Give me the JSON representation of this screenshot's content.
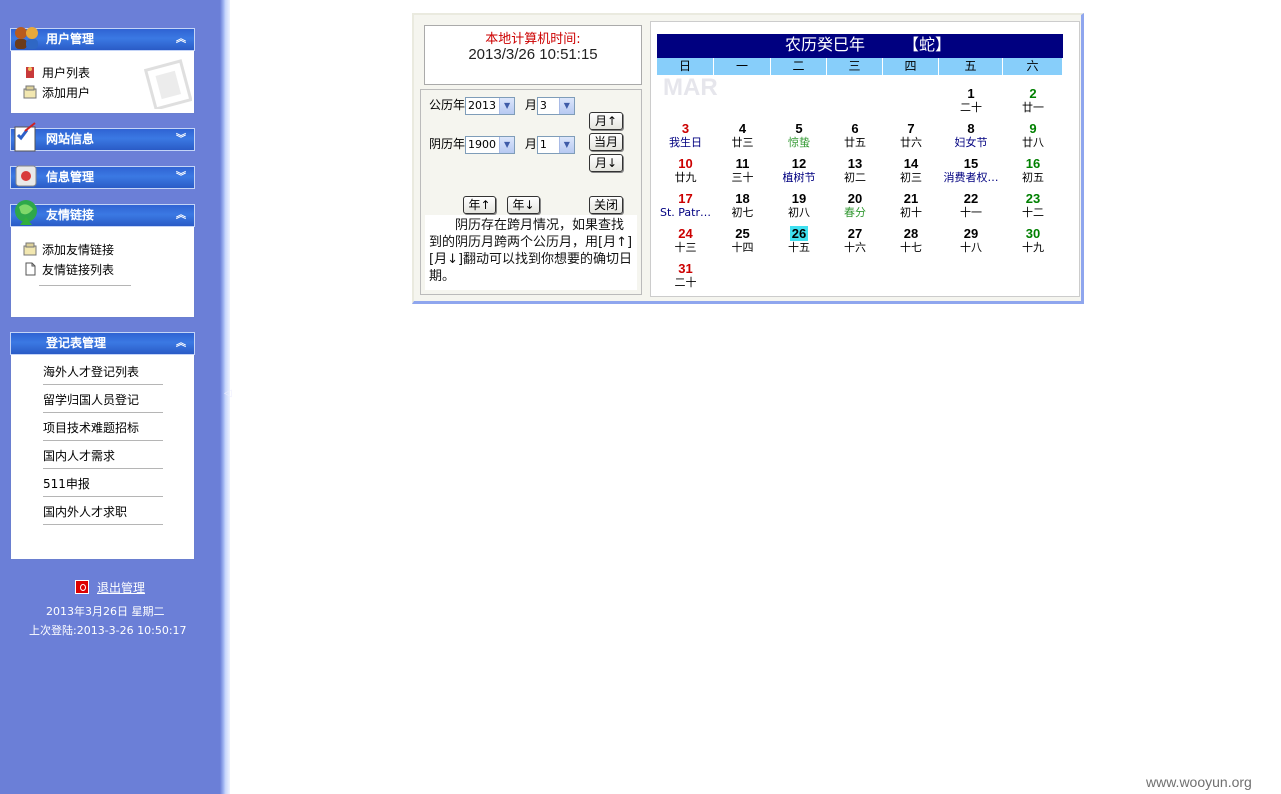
{
  "sidebar": {
    "panels": {
      "user_mgmt": {
        "title": "用户管理",
        "items": [
          "用户列表",
          "添加用户"
        ]
      },
      "site_info": {
        "title": "网站信息"
      },
      "info_mgmt": {
        "title": "信息管理"
      },
      "friend_links": {
        "title": "友情链接",
        "items": [
          "添加友情链接",
          "友情链接列表"
        ]
      },
      "registration": {
        "title": "登记表管理",
        "items": [
          "海外人才登记列表",
          "留学归国人员登记",
          "项目技术难题招标",
          "国内人才需求",
          "511申报",
          "国内外人才求职"
        ]
      }
    },
    "logout_label": "退出管理",
    "date_line": "2013年3月26日    星期二",
    "last_login": "上次登陆:2013-3-26  10:50:17"
  },
  "calendar": {
    "time_label": "本地计算机时间:",
    "time_value": "2013/3/26 10:51:15",
    "solar_year_label": "公历年",
    "solar_year_value": "2013",
    "solar_month_label": "月",
    "solar_month_value": "3",
    "lunar_year_label": "阴历年",
    "lunar_year_value": "1900",
    "lunar_month_label": "月",
    "lunar_month_value": "1",
    "btn_month_up": "月↑",
    "btn_this_month": "当月",
    "btn_month_down": "月↓",
    "btn_year_up": "年↑",
    "btn_year_down": "年↓",
    "btn_close": "关闭",
    "note": "阴历存在跨月情况，如果查找到的阴历月跨两个公历月，用[月↑][月↓]翻动可以找到你想要的确切日期。",
    "title_year": "农历癸巳年",
    "title_zodiac": "【蛇】",
    "bg_mar": "MAR",
    "weekdays": [
      "日",
      "一",
      "二",
      "三",
      "四",
      "五",
      "六"
    ],
    "colors": {
      "sunday": "#cc0000",
      "saturday": "#008000",
      "festival": "#000080",
      "term": "#339933",
      "today_bg": "#40e0f0"
    },
    "days": [
      {
        "n": "1",
        "l": "二十"
      },
      {
        "n": "2",
        "l": "廿一"
      },
      {
        "n": "3",
        "l": "我生日"
      },
      {
        "n": "4",
        "l": "廿三"
      },
      {
        "n": "5",
        "l": "惊蛰"
      },
      {
        "n": "6",
        "l": "廿五"
      },
      {
        "n": "7",
        "l": "廿六"
      },
      {
        "n": "8",
        "l": "妇女节"
      },
      {
        "n": "9",
        "l": "廿八"
      },
      {
        "n": "10",
        "l": "廿九"
      },
      {
        "n": "11",
        "l": "三十"
      },
      {
        "n": "12",
        "l": "植树节"
      },
      {
        "n": "13",
        "l": "初二"
      },
      {
        "n": "14",
        "l": "初三"
      },
      {
        "n": "15",
        "l": "消费者权…"
      },
      {
        "n": "16",
        "l": "初五"
      },
      {
        "n": "17",
        "l": "St. Patr…"
      },
      {
        "n": "18",
        "l": "初七"
      },
      {
        "n": "19",
        "l": "初八"
      },
      {
        "n": "20",
        "l": "春分"
      },
      {
        "n": "21",
        "l": "初十"
      },
      {
        "n": "22",
        "l": "十一"
      },
      {
        "n": "23",
        "l": "十二"
      },
      {
        "n": "24",
        "l": "十三"
      },
      {
        "n": "25",
        "l": "十四"
      },
      {
        "n": "26",
        "l": "十五"
      },
      {
        "n": "27",
        "l": "十六"
      },
      {
        "n": "28",
        "l": "十七"
      },
      {
        "n": "29",
        "l": "十八"
      },
      {
        "n": "30",
        "l": "十九"
      },
      {
        "n": "31",
        "l": "二十"
      }
    ],
    "festival_days": [
      "3",
      "8",
      "12",
      "15",
      "17"
    ],
    "term_days": [
      "5",
      "20"
    ],
    "today": "26",
    "first_weekday": 5
  },
  "watermark": "www.wooyun.org"
}
